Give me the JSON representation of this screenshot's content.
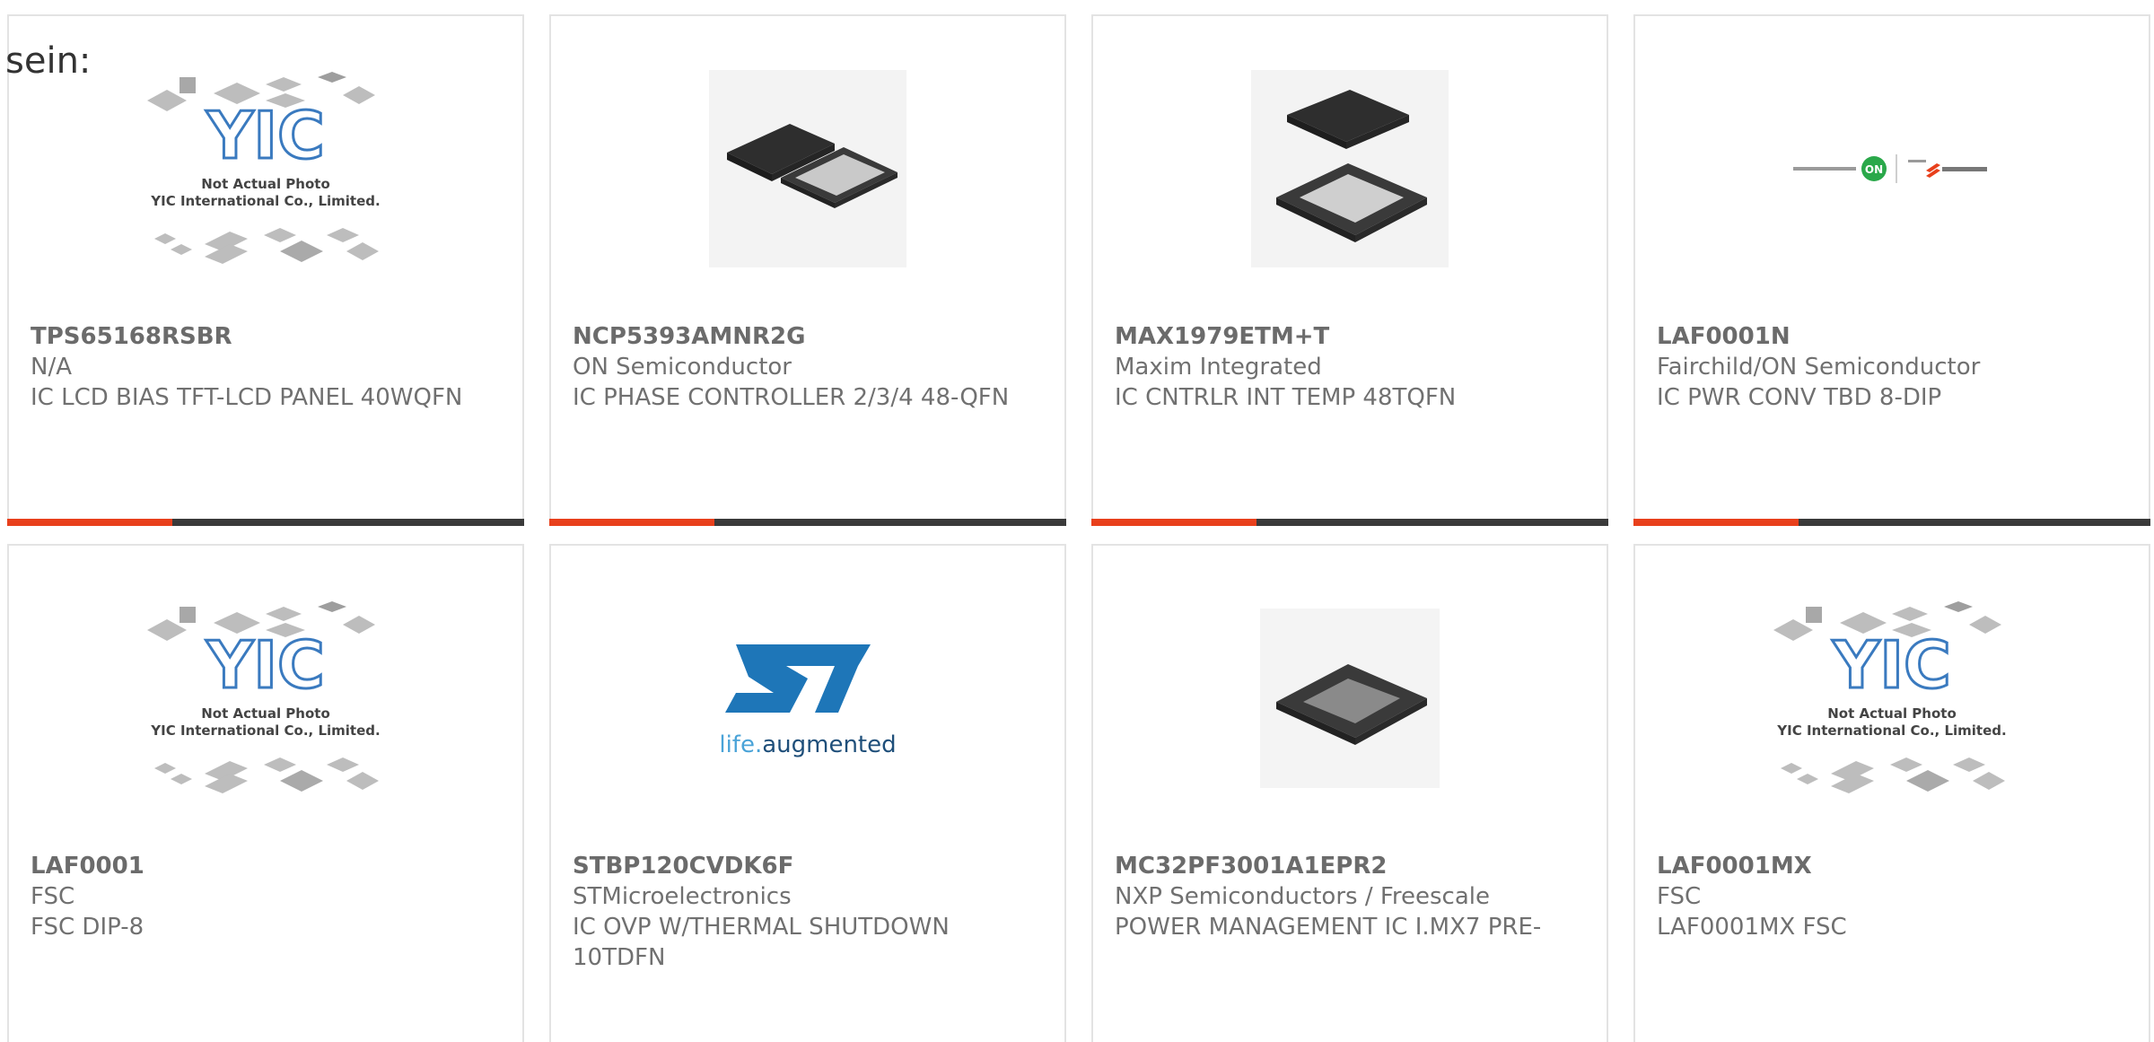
{
  "page": {
    "lead_text": "sein:"
  },
  "colors": {
    "accent": "#e8401c",
    "bar_dark": "#3a3a3a",
    "text": "#707070",
    "border": "#e3e3e3"
  },
  "placeholder": {
    "brand": "YIC",
    "line1": "Not Actual Photo",
    "line2": "YIC International Co., Limited."
  },
  "st_logo": {
    "tagline_a": "life.",
    "tagline_b": "augmented"
  },
  "products": [
    {
      "part_number": "TPS65168RSBR",
      "manufacturer": "N/A",
      "description": "IC LCD BIAS TFT-LCD PANEL 40WQFN",
      "image": "yic-placeholder"
    },
    {
      "part_number": "NCP5393AMNR2G",
      "manufacturer": "ON Semiconductor",
      "description": "IC PHASE CONTROLLER 2/3/4 48-QFN",
      "image": "qfn-chip-pair"
    },
    {
      "part_number": "MAX1979ETM+T",
      "manufacturer": "Maxim Integrated",
      "description": "IC CNTRLR INT TEMP 48TQFN",
      "image": "qfn-chip-stack"
    },
    {
      "part_number": "LAF0001N",
      "manufacturer": "Fairchild/ON Semiconductor",
      "description": "IC PWR CONV TBD 8-DIP",
      "image": "onsemi-fairchild-logo"
    },
    {
      "part_number": "LAF0001",
      "manufacturer": "FSC",
      "description": "FSC DIP-8",
      "image": "yic-placeholder"
    },
    {
      "part_number": "STBP120CVDK6F",
      "manufacturer": "STMicroelectronics",
      "description": "IC OVP W/THERMAL SHUTDOWN 10TDFN",
      "image": "st-logo"
    },
    {
      "part_number": "MC32PF3001A1EPR2",
      "manufacturer": "NXP Semiconductors / Freescale",
      "description": "POWER MANAGEMENT IC I.MX7 PRE-",
      "image": "qfn-chip-single"
    },
    {
      "part_number": "LAF0001MX",
      "manufacturer": "FSC",
      "description": "LAF0001MX FSC",
      "image": "yic-placeholder"
    }
  ]
}
